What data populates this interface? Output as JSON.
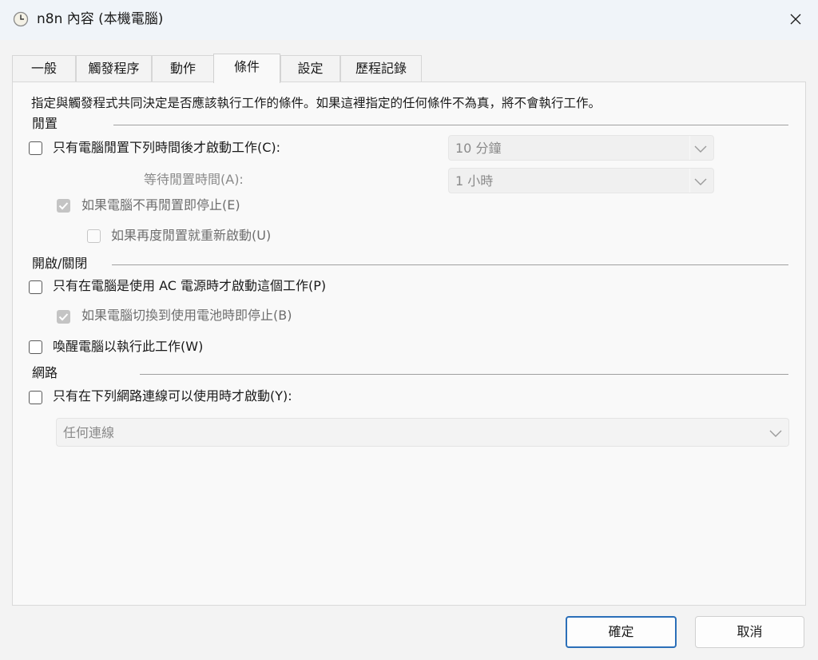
{
  "window": {
    "title": "n8n 內容 (本機電腦)",
    "icon": "task-scheduler-clock-icon"
  },
  "tabs": [
    {
      "label": "一般",
      "active": false
    },
    {
      "label": "觸發程序",
      "active": false
    },
    {
      "label": "動作",
      "active": false
    },
    {
      "label": "條件",
      "active": true
    },
    {
      "label": "設定",
      "active": false
    },
    {
      "label": "歷程記錄",
      "active": false
    }
  ],
  "description": "指定與觸發程式共同決定是否應該執行工作的條件。如果這裡指定的任何條件不為真，將不會執行工作。",
  "idle": {
    "header": "閒置",
    "start_if_idle": {
      "label": "只有電腦閒置下列時間後才啟動工作(C):",
      "checked": false
    },
    "idle_duration": {
      "value": "10 分鐘",
      "enabled": false
    },
    "wait_label": "等待閒置時間(A):",
    "wait_value": {
      "value": "1 小時",
      "enabled": false
    },
    "stop_if_not_idle": {
      "label": "如果電腦不再閒置即停止(E)",
      "checked": true,
      "enabled": false
    },
    "restart_if_idle": {
      "label": "如果再度閒置就重新啟動(U)",
      "checked": false,
      "enabled": false
    }
  },
  "power": {
    "header": "開啟/關閉",
    "ac_only": {
      "label": "只有在電腦是使用 AC 電源時才啟動這個工作(P)",
      "checked": false
    },
    "stop_on_battery": {
      "label": "如果電腦切換到使用電池時即停止(B)",
      "checked": true,
      "enabled": false
    },
    "wake": {
      "label": "喚醒電腦以執行此工作(W)",
      "checked": false
    }
  },
  "network": {
    "header": "網路",
    "only_if_network": {
      "label": "只有在下列網路連線可以使用時才啟動(Y):",
      "checked": false
    },
    "connection": {
      "value": "任何連線",
      "enabled": false
    }
  },
  "buttons": {
    "ok": "確定",
    "cancel": "取消"
  },
  "colors": {
    "accent": "#2b6fb8",
    "titlebar": "#f0f4f9",
    "background": "#f3f3f3"
  }
}
